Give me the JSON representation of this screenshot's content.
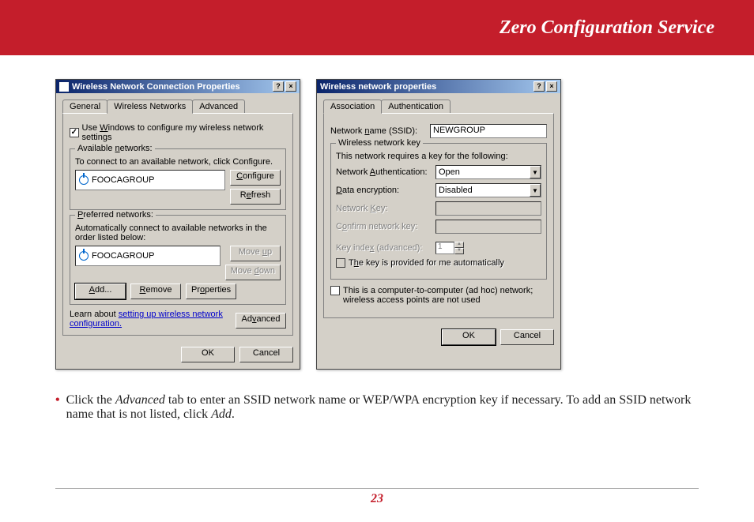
{
  "banner": {
    "title": "Zero Configuration Service"
  },
  "dialog1": {
    "title": "Wireless Network Connection Properties",
    "tabs": {
      "general": "General",
      "wireless": "Wireless Networks",
      "advanced": "Advanced"
    },
    "use_windows_label": "Use Windows to configure my wireless network settings",
    "available": {
      "legend": "Available networks:",
      "hint": "To connect to an available network, click Configure.",
      "item": "FOOCAGROUP",
      "configure": "Configure",
      "refresh": "Refresh"
    },
    "preferred": {
      "legend": "Preferred networks:",
      "hint": "Automatically connect to available networks in the order listed below:",
      "item": "FOOCAGROUP",
      "move_up": "Move up",
      "move_down": "Move down",
      "add": "Add...",
      "remove": "Remove",
      "properties": "Properties"
    },
    "learn_text": "Learn about ",
    "learn_link": "setting up wireless network configuration.",
    "advanced_btn": "Advanced",
    "ok": "OK",
    "cancel": "Cancel"
  },
  "dialog2": {
    "title": "Wireless network properties",
    "tabs": {
      "assoc": "Association",
      "auth": "Authentication"
    },
    "ssid_label": "Network name (SSID):",
    "ssid_value": "NEWGROUP",
    "key_group": {
      "legend": "Wireless network key",
      "hint": "This network requires a key for the following:",
      "auth_label": "Network Authentication:",
      "auth_value": "Open",
      "enc_label": "Data encryption:",
      "enc_value": "Disabled",
      "netkey_label": "Network Key:",
      "confirm_label": "Confirm network key:",
      "index_label": "Key index (advanced):",
      "index_value": "1",
      "auto_label": "The key is provided for me automatically"
    },
    "adhoc_label": "This is a computer-to-computer (ad hoc) network; wireless access points are not used",
    "ok": "OK",
    "cancel": "Cancel"
  },
  "instruction": {
    "pre": "Click the ",
    "em1": "Advanced",
    "mid": " tab to enter an SSID network name or WEP/WPA encryption key if necessary.  To add an SSID network name that is not listed, click ",
    "em2": "Add",
    "post": "."
  },
  "page_number": "23"
}
